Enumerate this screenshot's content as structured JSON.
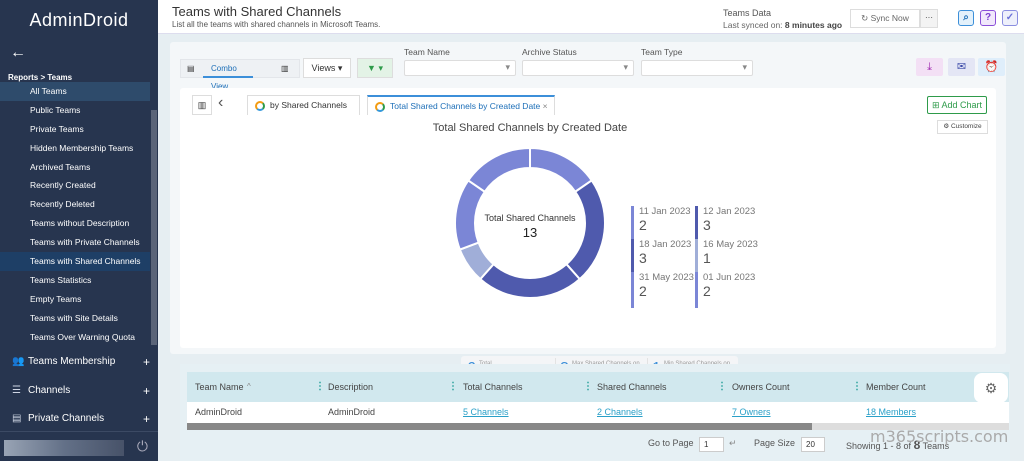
{
  "sidebar": {
    "logo": "AdminDroid",
    "breadcrumb": "Reports > Teams",
    "items": [
      "All Teams",
      "Public Teams",
      "Private Teams",
      "Hidden Membership Teams",
      "Archived Teams",
      "Recently Created",
      "Recently Deleted",
      "Teams without Description",
      "Teams with Private Channels",
      "Teams with Shared Channels",
      "Teams Statistics",
      "Empty Teams",
      "Teams with Site Details",
      "Teams Over Warning Quota"
    ],
    "selected": "Teams with Shared Channels",
    "groups": [
      "Teams Membership",
      "Channels",
      "Private Channels"
    ]
  },
  "header": {
    "title": "Teams with Shared Channels",
    "subtitle": "List all the teams with shared channels in Microsoft Teams.",
    "data_title": "Teams Data",
    "synced_label": "Last synced on:",
    "synced_value": "8 minutes ago",
    "sync_button": "Sync Now",
    "more": "···"
  },
  "toolbar": {
    "combo_view": "Combo View",
    "views": "Views",
    "filters": [
      {
        "label": "Team Name",
        "value": ""
      },
      {
        "label": "Archive Status",
        "value": ""
      },
      {
        "label": "Team Type",
        "value": ""
      }
    ]
  },
  "chart_tabs": [
    "by Shared Channels",
    "Total Shared Channels by Created Date"
  ],
  "add_chart": "Add Chart",
  "customize": "Customize",
  "chart_data": {
    "type": "pie",
    "title": "Total Shared Channels by Created Date",
    "center_label": "Total Shared Channels",
    "total": 13,
    "categories": [
      "11 Jan 2023",
      "12 Jan 2023",
      "18 Jan 2023",
      "16 May 2023",
      "31 May 2023",
      "01 Jun 2023"
    ],
    "values": [
      2,
      3,
      3,
      1,
      2,
      2
    ],
    "colors": [
      "#7b86d6",
      "#4f5aad",
      "#4f5aad",
      "#a0aed8",
      "#7b86d6",
      "#7b86d6"
    ]
  },
  "stats": [
    {
      "n": "6",
      "t1": "Total",
      "t2": "Created active days"
    },
    {
      "n": "3",
      "t1": "Max Shared Channels on",
      "t2": "18 Jan 2023"
    },
    {
      "n": "1",
      "t1": "Min Shared Channels on",
      "t2": "16 May 2023"
    }
  ],
  "table": {
    "columns": [
      "Team Name",
      "Description",
      "Total Channels",
      "Shared Channels",
      "Owners Count",
      "Member Count"
    ],
    "rows": [
      [
        "AdminDroid",
        "AdminDroid",
        "5 Channels",
        "2 Channels",
        "7 Owners",
        "18 Members"
      ]
    ]
  },
  "pager": {
    "go_to_page": "Go to Page",
    "page": "1",
    "page_size_label": "Page Size",
    "page_size": "20",
    "showing": "Showing 1 - 8 of",
    "count": "8",
    "unit": "Teams"
  },
  "watermark": "m365scripts.com"
}
